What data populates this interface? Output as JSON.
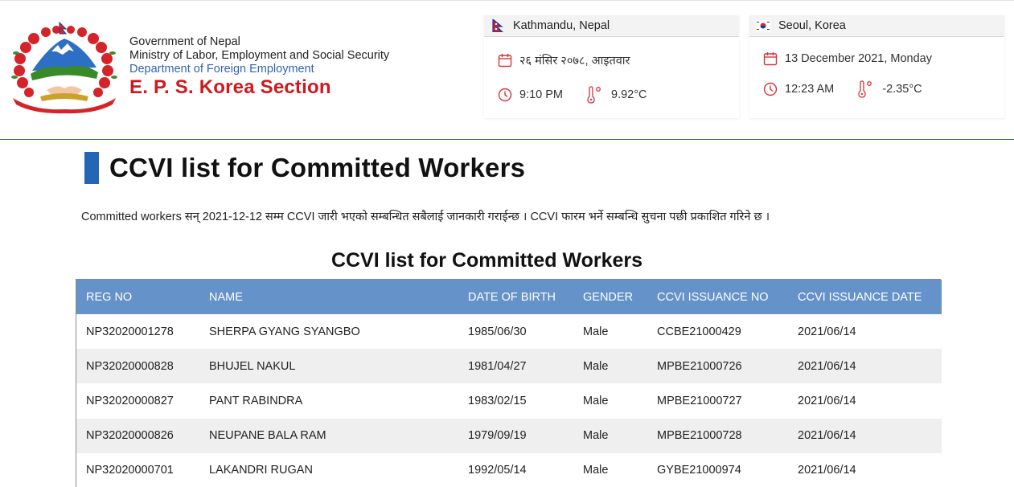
{
  "header": {
    "emblem": "nepal-government-emblem",
    "org_line1": "Government of Nepal",
    "org_line2": "Ministry of Labor, Employment and Social Security",
    "org_line3": "Department of Foreign Employment",
    "org_line4": "E. P. S. Korea Section",
    "colors": {
      "accent_blue": "#3264b0",
      "accent_red": "#d0181e",
      "divider": "#2d63a7"
    }
  },
  "clocks": [
    {
      "flag": "nepal-flag-icon",
      "city": "Kathmandu, Nepal",
      "date": "२६ मंसिर २०७८, आइतवार",
      "time": "9:10 PM",
      "temperature": "9.92°C"
    },
    {
      "flag": "korea-flag-icon",
      "city": "Seoul, Korea",
      "date": "13 December 2021, Monday",
      "time": "12:23 AM",
      "temperature": "-2.35°C"
    }
  ],
  "main": {
    "title": "CCVI list for Committed Workers",
    "notice": "Committed workers सन् 2021-12-12 सम्म CCVI जारी भएको सम्बन्धित सबैलाई जानकारी गराईन्छ । CCVI फारम भर्ने सम्बन्धि सुचना पछी प्रकाशित गरिने छ ।",
    "table_title": "CCVI list for Committed Workers",
    "table": {
      "header_color": "#6592c8",
      "columns": [
        "REG NO",
        "NAME",
        "DATE OF BIRTH",
        "GENDER",
        "CCVI ISSUANCE NO",
        "CCVI ISSUANCE DATE"
      ],
      "rows": [
        [
          "NP32020001278",
          "SHERPA GYANG SYANGBO",
          "1985/06/30",
          "Male",
          "CCBE21000429",
          "2021/06/14"
        ],
        [
          "NP32020000828",
          "BHUJEL NAKUL",
          "1981/04/27",
          "Male",
          "MPBE21000726",
          "2021/06/14"
        ],
        [
          "NP32020000827",
          "PANT RABINDRA",
          "1983/02/15",
          "Male",
          "MPBE21000727",
          "2021/06/14"
        ],
        [
          "NP32020000826",
          "NEUPANE BALA RAM",
          "1979/09/19",
          "Male",
          "MPBE21000728",
          "2021/06/14"
        ],
        [
          "NP32020000701",
          "LAKANDRI RUGAN",
          "1992/05/14",
          "Male",
          "GYBE21000974",
          "2021/06/14"
        ]
      ]
    }
  }
}
